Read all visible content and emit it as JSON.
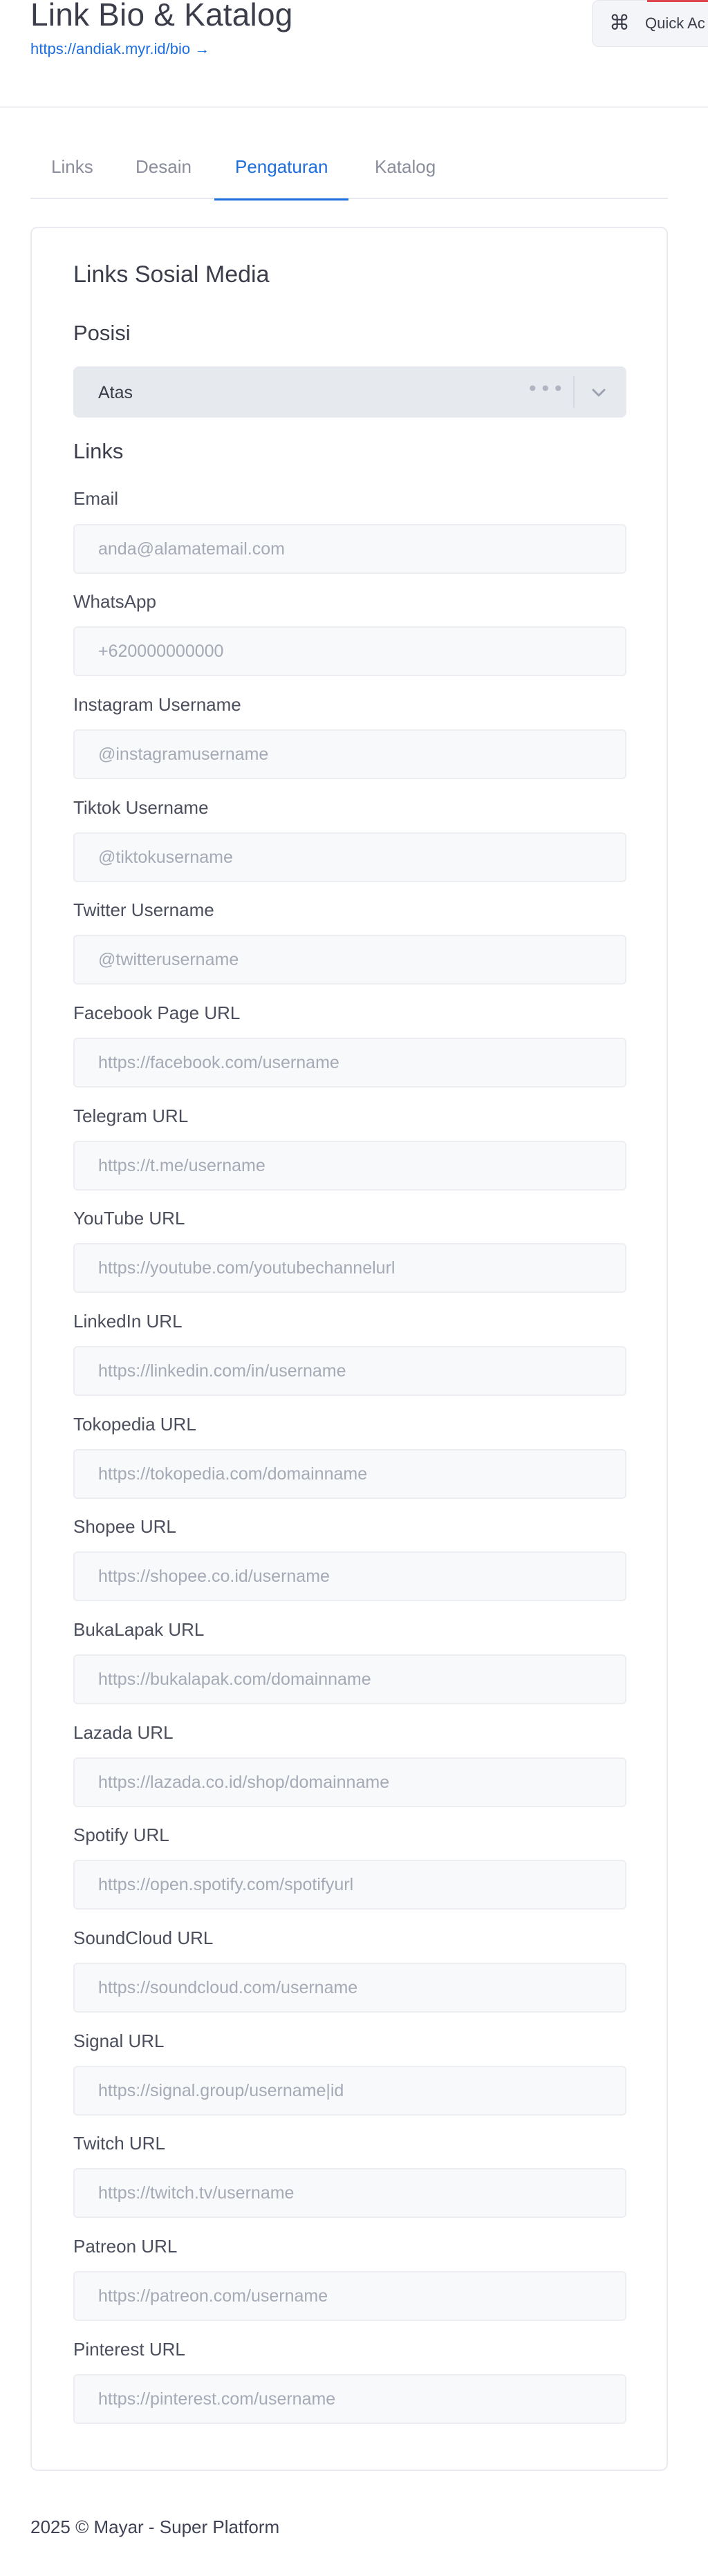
{
  "header": {
    "title": "Link Bio & Katalog",
    "link": "https://andiak.myr.id/bio →",
    "quick_action": "Quick Ac",
    "quick_icon": "⌘"
  },
  "tabs": [
    {
      "label": "Links",
      "active": false
    },
    {
      "label": "Desain",
      "active": false
    },
    {
      "label": "Pengaturan",
      "active": true
    },
    {
      "label": "Katalog",
      "active": false
    }
  ],
  "card": {
    "title": "Links Sosial Media",
    "position_heading": "Posisi",
    "position_select": {
      "value": "Atas"
    },
    "links_heading": "Links"
  },
  "fields": [
    {
      "label": "Email",
      "placeholder": "anda@alamatemail.com"
    },
    {
      "label": "WhatsApp",
      "placeholder": "+620000000000"
    },
    {
      "label": "Instagram Username",
      "placeholder": "@instagramusername"
    },
    {
      "label": "Tiktok Username",
      "placeholder": "@tiktokusername"
    },
    {
      "label": "Twitter Username",
      "placeholder": "@twitterusername"
    },
    {
      "label": "Facebook Page URL",
      "placeholder": "https://facebook.com/username"
    },
    {
      "label": "Telegram URL",
      "placeholder": "https://t.me/username"
    },
    {
      "label": "YouTube URL",
      "placeholder": "https://youtube.com/youtubechannelurl"
    },
    {
      "label": "LinkedIn URL",
      "placeholder": "https://linkedin.com/in/username"
    },
    {
      "label": "Tokopedia URL",
      "placeholder": "https://tokopedia.com/domainname"
    },
    {
      "label": "Shopee URL",
      "placeholder": "https://shopee.co.id/username"
    },
    {
      "label": "BukaLapak URL",
      "placeholder": "https://bukalapak.com/domainname"
    },
    {
      "label": "Lazada URL",
      "placeholder": "https://lazada.co.id/shop/domainname"
    },
    {
      "label": "Spotify URL",
      "placeholder": "https://open.spotify.com/spotifyurl"
    },
    {
      "label": "SoundCloud URL",
      "placeholder": "https://soundcloud.com/username"
    },
    {
      "label": "Signal URL",
      "placeholder": "https://signal.group/username|id"
    },
    {
      "label": "Twitch URL",
      "placeholder": "https://twitch.tv/username"
    },
    {
      "label": "Patreon URL",
      "placeholder": "https://patreon.com/username"
    },
    {
      "label": "Pinterest URL",
      "placeholder": "https://pinterest.com/username"
    }
  ],
  "footer": {
    "text": "2025 © Mayar - Super Platform"
  },
  "colors": {
    "accent": "#1d6fe0",
    "brand_red": "#e0474c"
  }
}
